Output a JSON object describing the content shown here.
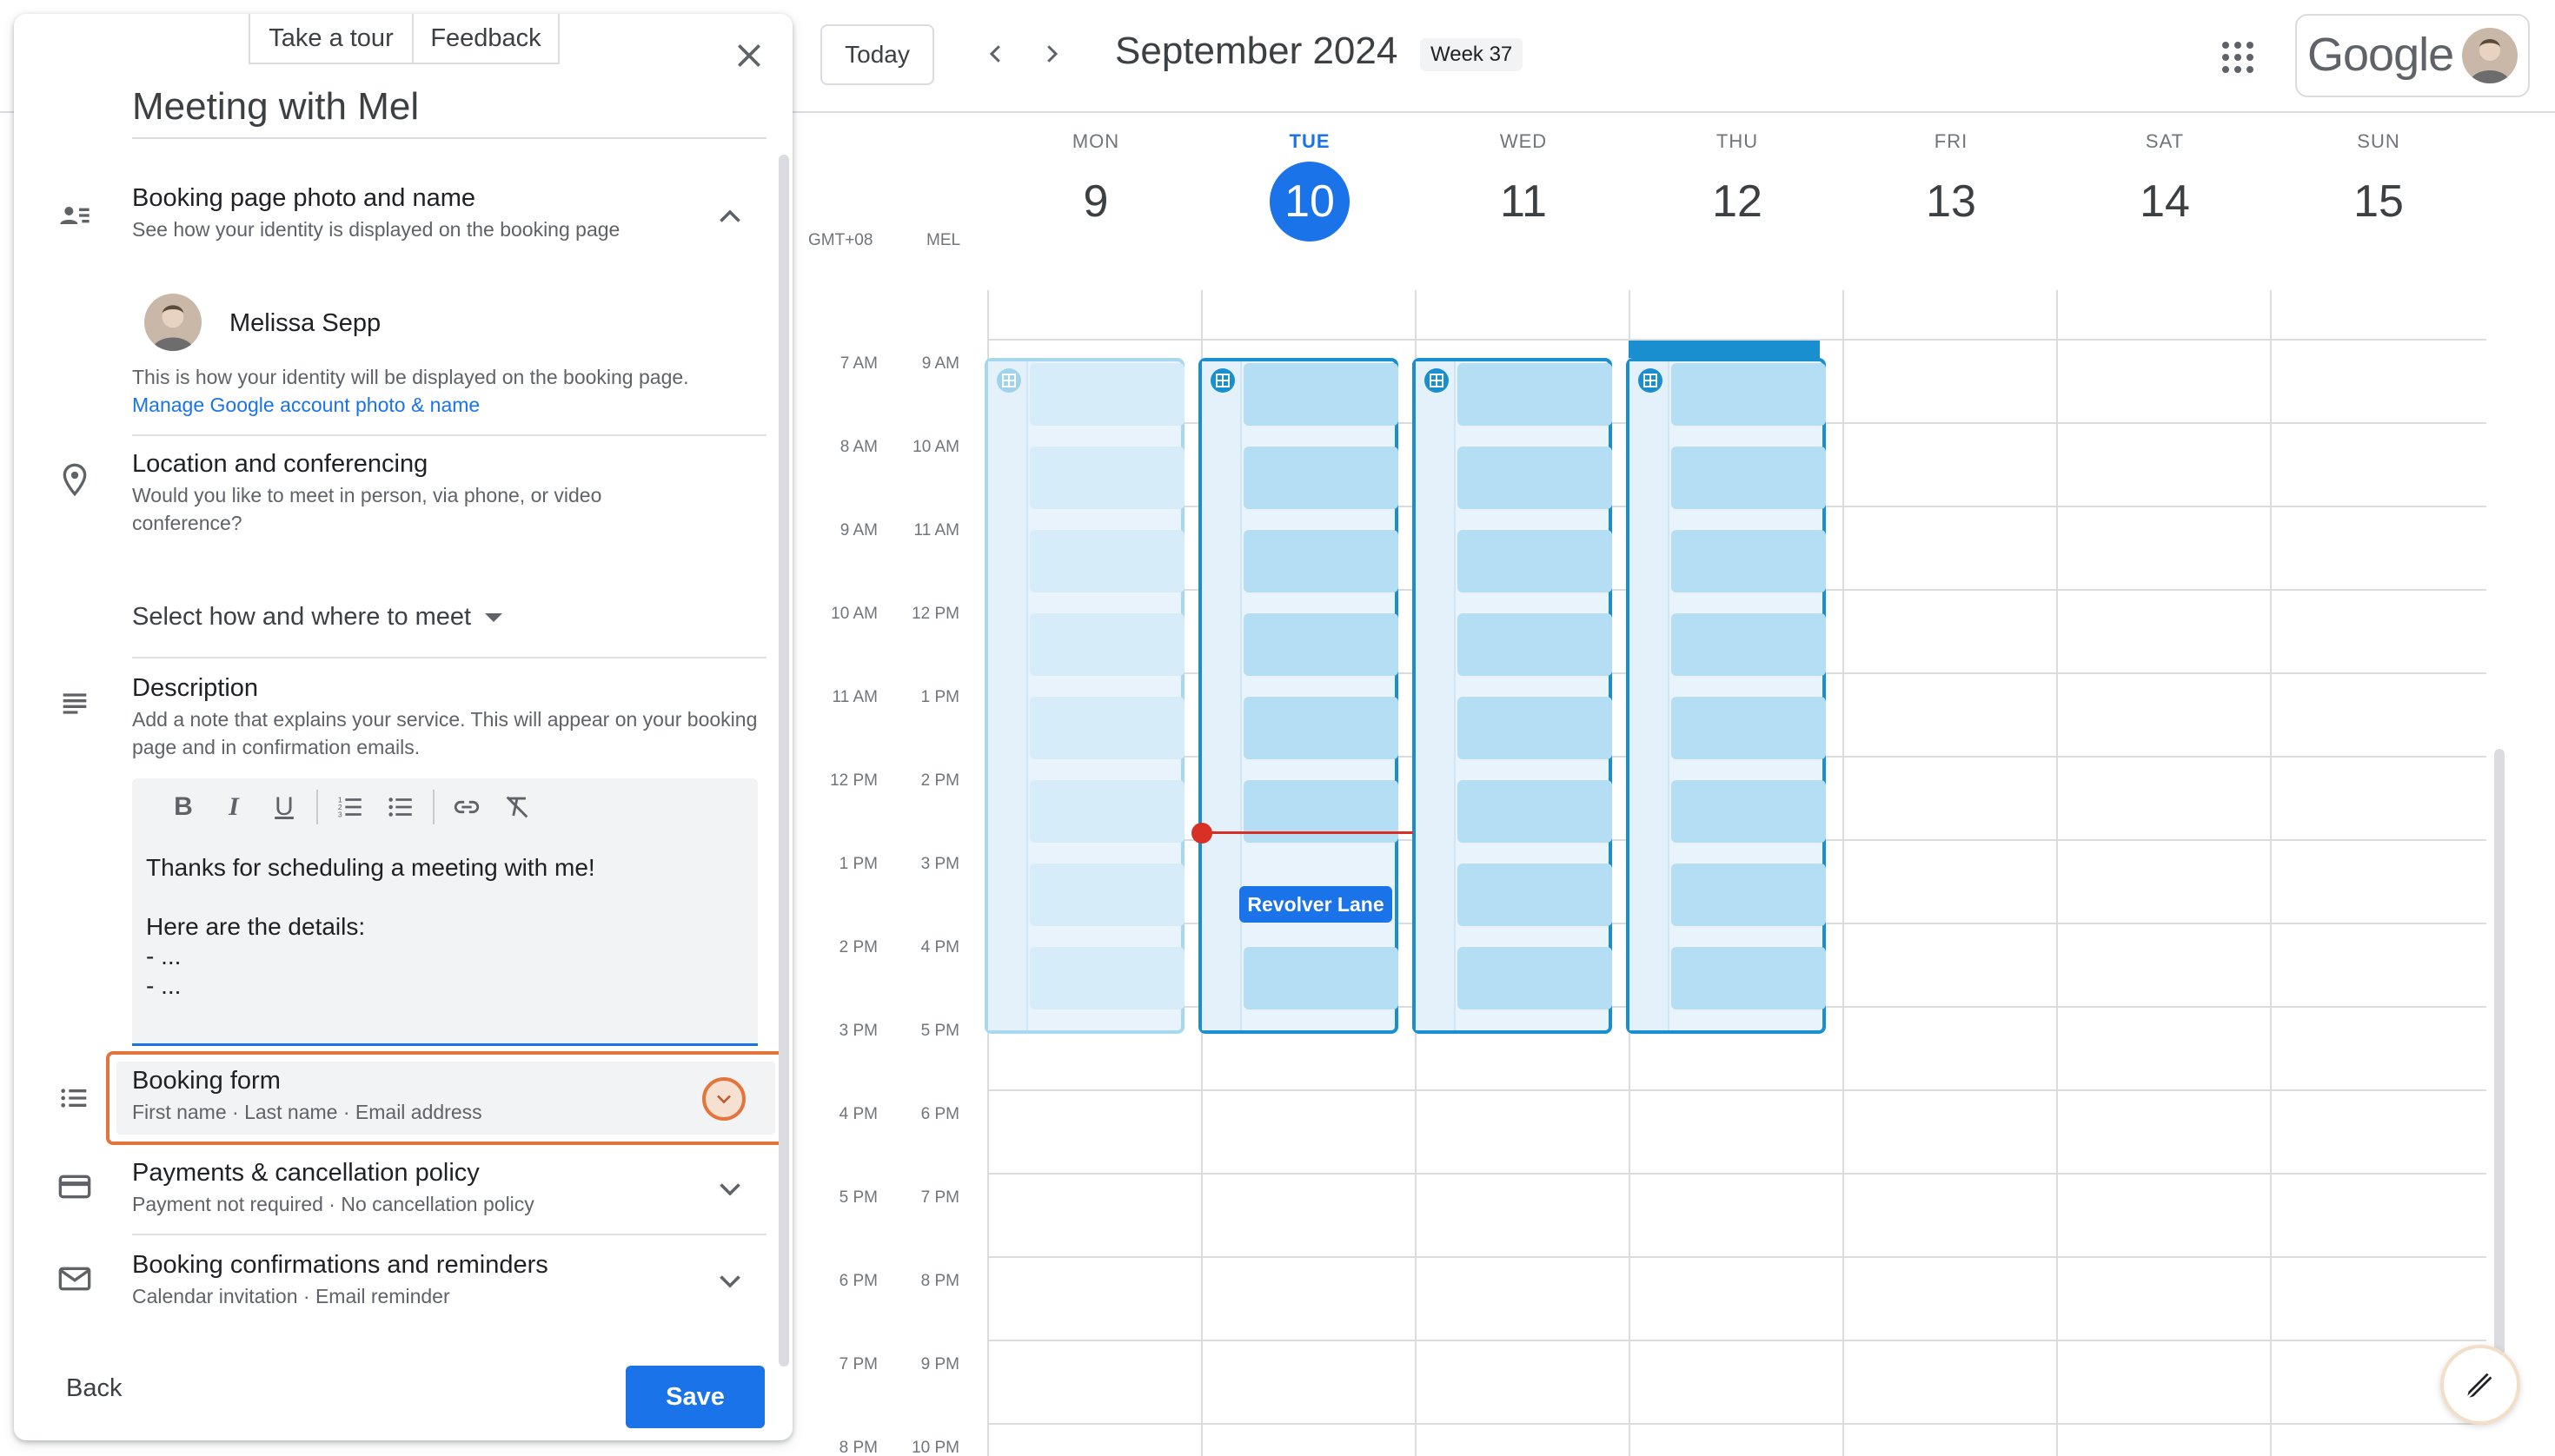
{
  "panel": {
    "tour_label": "Take a tour",
    "feedback_label": "Feedback",
    "title": "Meeting with Mel",
    "sections": {
      "photo": {
        "title": "Booking page photo and name",
        "subtitle": "See how your identity is displayed on the booking page",
        "person_name": "Melissa Sepp",
        "note": "This is how your identity will be displayed on the booking page.",
        "link": "Manage Google account photo & name"
      },
      "location": {
        "title": "Location and conferencing",
        "subtitle": "Would you like to meet in person, via phone, or video conference?",
        "select_label": "Select how and where to meet"
      },
      "description": {
        "title": "Description",
        "subtitle": "Add a note that explains your service. This will appear on your booking page and in confirmation emails.",
        "text": "Thanks for scheduling a meeting with me!\n\nHere are the details:\n- ...\n- ..."
      },
      "booking_form": {
        "title": "Booking form",
        "subtitle": "First name · Last name · Email address"
      },
      "payments": {
        "title": "Payments & cancellation policy",
        "subtitle": "Payment not required · No cancellation policy"
      },
      "confirmations": {
        "title": "Booking confirmations and reminders",
        "subtitle": "Calendar invitation · Email reminder"
      }
    },
    "back_label": "Back",
    "save_label": "Save"
  },
  "calendar": {
    "today_label": "Today",
    "month_title": "September 2024",
    "week_label": "Week 37",
    "brand": "Google",
    "timezones": [
      "GMT+08",
      "MEL"
    ],
    "days": [
      {
        "dow": "MON",
        "num": "9"
      },
      {
        "dow": "TUE",
        "num": "10",
        "today": true
      },
      {
        "dow": "WED",
        "num": "11"
      },
      {
        "dow": "THU",
        "num": "12"
      },
      {
        "dow": "FRI",
        "num": "13"
      },
      {
        "dow": "SAT",
        "num": "14"
      },
      {
        "dow": "SUN",
        "num": "15"
      }
    ],
    "times_local": [
      "7 AM",
      "8 AM",
      "9 AM",
      "10 AM",
      "11 AM",
      "12 PM",
      "1 PM",
      "2 PM",
      "3 PM",
      "4 PM",
      "5 PM",
      "6 PM",
      "7 PM",
      "8 PM"
    ],
    "times_mel": [
      "9 AM",
      "10 AM",
      "11 AM",
      "12 PM",
      "1 PM",
      "2 PM",
      "3 PM",
      "4 PM",
      "5 PM",
      "6 PM",
      "7 PM",
      "8 PM",
      "9 PM",
      "10 PM"
    ],
    "event_label": "Revolver Lane"
  },
  "colors": {
    "accent": "#1a73e8",
    "highlight": "#e3743b",
    "now_line": "#d93025",
    "slot": "#b3def3"
  }
}
